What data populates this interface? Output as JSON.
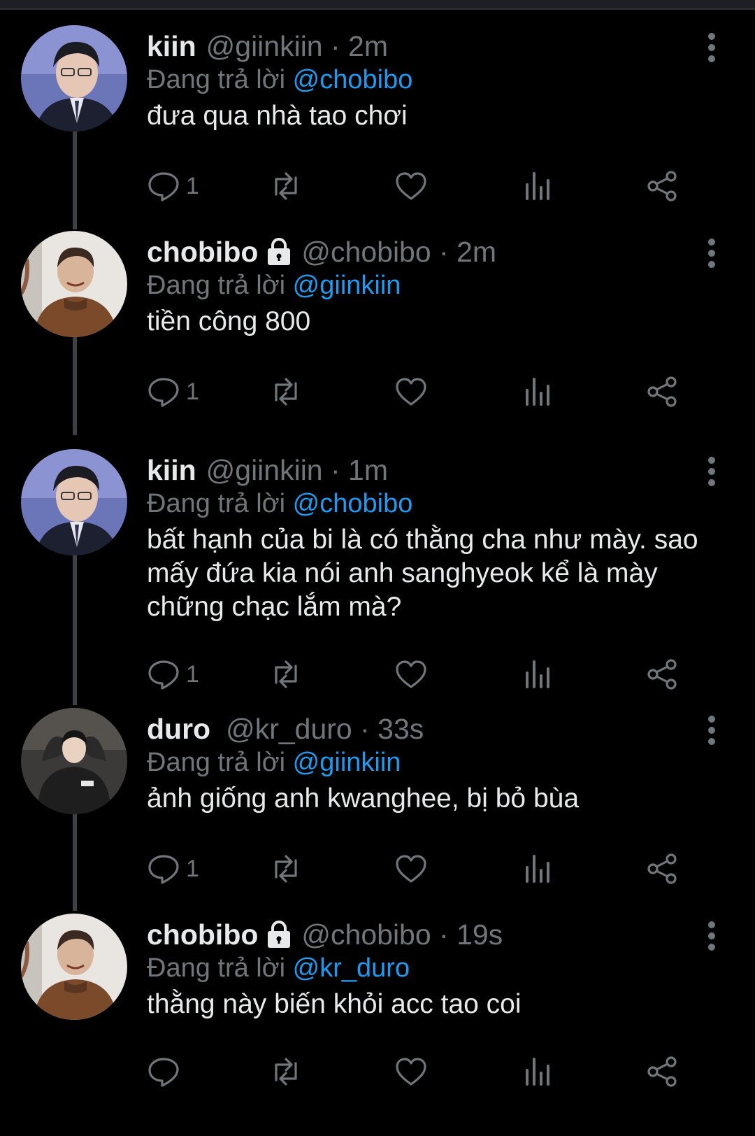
{
  "tweets": [
    {
      "name": "kiin",
      "locked": false,
      "handle_time": "@giinkiin · 2m",
      "reply_prefix": "Đang trả lời",
      "reply_to": "@chobibo",
      "text": "đưa qua nhà tao chơi",
      "reply_count": "1",
      "avatar": "kiin-avatar"
    },
    {
      "name": "chobibo",
      "locked": true,
      "handle_time": "@chobibo · 2m",
      "reply_prefix": "Đang trả lời",
      "reply_to": "@giinkiin",
      "text": "tiền công 800",
      "reply_count": "1",
      "avatar": "chobibo-avatar"
    },
    {
      "name": "kiin",
      "locked": false,
      "handle_time": "@giinkiin · 1m",
      "reply_prefix": "Đang trả lời",
      "reply_to": "@chobibo",
      "text": "bất hạnh của bi là có thằng cha như mày. sao mấy đứa kia nói anh sanghyeok kể là mày chững chạc lắm mà?",
      "reply_count": "1",
      "avatar": "kiin-avatar"
    },
    {
      "name": "duro",
      "locked": false,
      "handle_time": "@kr_duro · 33s",
      "reply_prefix": "Đang trả lời",
      "reply_to": "@giinkiin",
      "text": "ảnh giống anh kwanghee, bị bỏ bùa",
      "reply_count": "1",
      "avatar": "duro-avatar"
    },
    {
      "name": "chobibo",
      "locked": true,
      "handle_time": "@chobibo · 19s",
      "reply_prefix": "Đang trả lời",
      "reply_to": "@kr_duro",
      "text": "thằng này biến khỏi acc tao coi",
      "reply_count": "",
      "avatar": "chobibo-avatar"
    }
  ],
  "icons": {
    "reply": "reply-icon",
    "retweet": "retweet-icon",
    "like": "heart-icon",
    "views": "views-icon",
    "share": "share-icon",
    "more": "more-icon",
    "lock": "lock-icon"
  },
  "colors": {
    "background": "#000000",
    "text": "#e7e9ea",
    "muted": "#71767b",
    "mention": "#1d9bf0",
    "thread_line": "#3d4145"
  }
}
